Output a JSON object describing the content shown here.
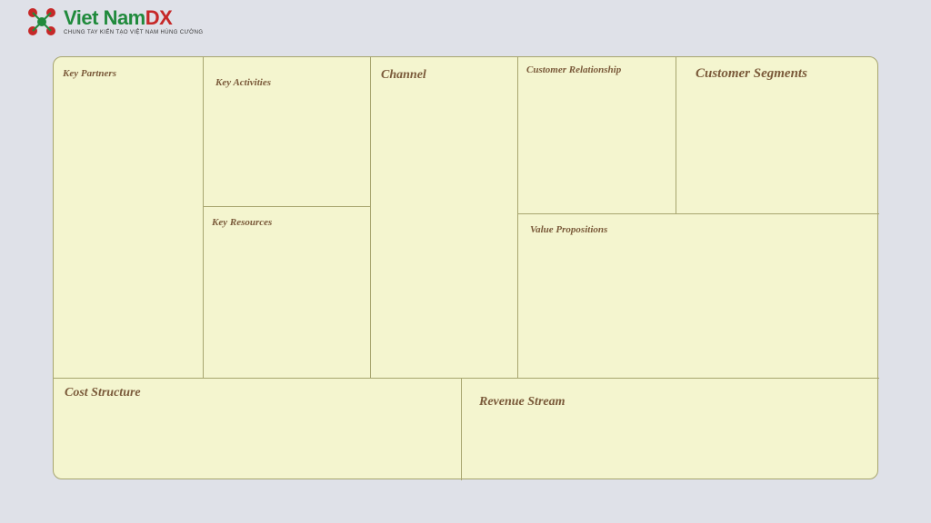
{
  "logo": {
    "brand_green": "Viet Nam",
    "brand_red": "DX",
    "tagline": "CHUNG TAY KIẾN TẠO VIỆT NAM HÙNG CƯỜNG"
  },
  "canvas": {
    "key_partners": "Key Partners",
    "key_activities": "Key Activities",
    "key_resources": "Key Resources",
    "channel": "Channel",
    "customer_relationship": "Customer Relationship",
    "customer_segments": "Customer Segments",
    "value_propositions": "Value Propositions",
    "cost_structure": "Cost Structure",
    "revenue_stream": "Revenue Stream"
  },
  "colors": {
    "page_bg": "#dfe1e8",
    "canvas_bg": "#f4f5cf",
    "border": "#a7a56f",
    "label": "#7a5a3a",
    "logo_green": "#208a3c",
    "logo_red": "#c62828"
  }
}
